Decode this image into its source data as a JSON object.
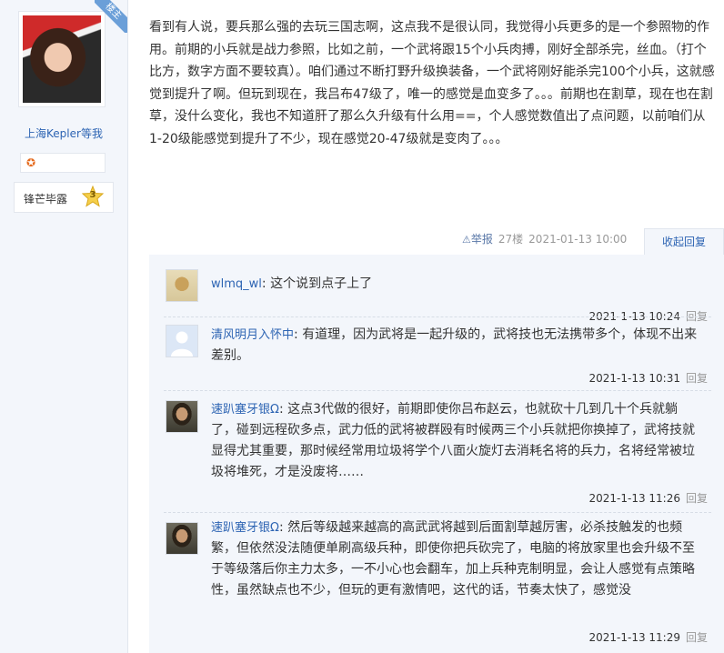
{
  "author": {
    "floor_badge": "楼主",
    "username": "上海Kepler等我",
    "medal_icon": "medal-icon",
    "rank_title": "锋芒毕露",
    "rank_level": "3"
  },
  "post": {
    "body": "看到有人说，要兵那么强的去玩三国志啊，这点我不是很认同，我觉得小兵更多的是一个参照物的作用。前期的小兵就是战力参照，比如之前，一个武将跟15个小兵肉搏，刚好全部杀完，丝血。（打个比方，数字方面不要较真）。咱们通过不断打野升级换装备，一个武将刚好能杀完100个小兵，这就感觉到提升了啊。但玩到现在，我吕布47级了，唯一的感觉是血变多了。。。前期也在割草，现在也在割草，没什么变化，我也不知道肝了那么久升级有什么用==，个人感觉数值出了点问题，以前咱们从1-20级能感觉到提升了不少，现在感觉20-47级就是变肉了。。。",
    "report_label": "举报",
    "floor": "27楼",
    "time": "2021-01-13 10:00",
    "collapse_label": "收起回复"
  },
  "replies": [
    {
      "user": "wlmq_wl",
      "icon": "",
      "sep": ": ",
      "text": "这个说到点子上了",
      "time": "2021-1-13 10:24",
      "reply_label": "回复",
      "avatar": "cartoon-avatar"
    },
    {
      "user": "清风明月入怀中",
      "icon": "",
      "sep": ": ",
      "text": "有道理，因为武将是一起升级的，武将技也无法携带多个，体现不出来差别。",
      "time": "2021-1-13 10:31",
      "reply_label": "回复",
      "avatar": "default-avatar"
    },
    {
      "user": "速趴塞牙银",
      "icon": "Ω",
      "sep": ": ",
      "text": "这点3代做的很好，前期即使你吕布赵云，也就砍十几到几十个兵就躺了，碰到远程砍多点，武力低的武将被群殴有时候两三个小兵就把你换掉了，武将技就显得尤其重要，那时候经常用垃圾将学个八面火旋灯去消耗名将的兵力，名将经常被垃圾将堆死，才是没废将……",
      "time": "2021-1-13 11:26",
      "reply_label": "回复",
      "avatar": "photo-avatar"
    },
    {
      "user": "速趴塞牙银",
      "icon": "Ω",
      "sep": ": ",
      "text": "然后等级越来越高的高武武将越到后面割草越厉害，必杀技触发的也频繁，但依然没法随便单刷高级兵种，即使你把兵砍完了，电脑的将放家里也会升级不至于等级落后你主力太多，一不小心也会翻车，加上兵种克制明显，会让人感觉有点策略性，虽然缺点也不少，但玩的更有激情吧，这代的话，节奏太快了，感觉没",
      "time": "2021-1-13 11:29",
      "reply_label": "回复",
      "avatar": "photo-avatar"
    }
  ]
}
